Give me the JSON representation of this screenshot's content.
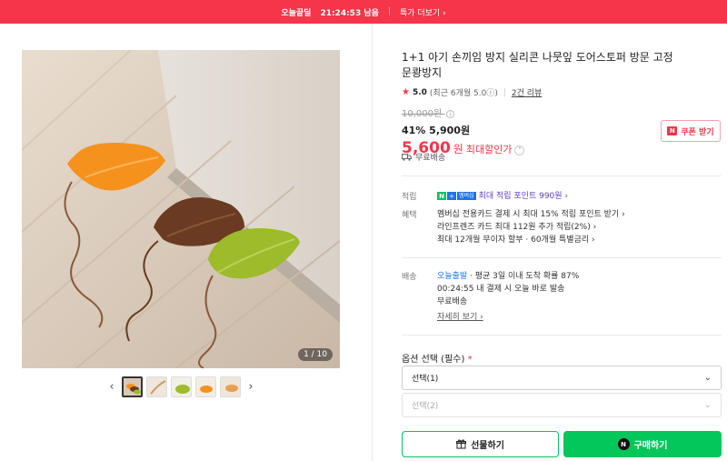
{
  "topbar": {
    "label": "오늘끝딜",
    "timer": "21:24:53 남음",
    "more": "특가 더보기 ›"
  },
  "gallery": {
    "counter": "1 / 10",
    "prev_icon": "chevron-left-icon",
    "next_icon": "chevron-right-icon",
    "thumb_count": 5
  },
  "product": {
    "title": "1+1 아기 손끼임 방지 실리콘 나뭇잎 도어스토퍼 방문 고정 문쾅방지",
    "rating_score": "5.0",
    "rating_recent": "(최근 6개월 5.0ⓘ)",
    "review_count": "2건 리뷰",
    "original_price": "10,000원",
    "discount": "41% 5,900원",
    "final_price": "5,600",
    "final_unit": "원",
    "final_label": "최대할인가",
    "shipping_free": "무료배송"
  },
  "coupon": {
    "label": "쿠폰 받기"
  },
  "info": {
    "point_key": "적립",
    "point_text": "최대 적립 포인트 990원 ›",
    "benefit_key": "혜택",
    "benefit_lines": [
      "멤버십 전용카드 결제 시 최대 15% 적립 포인트 받기 ›",
      "라인프렌즈 카드 최대 112원 추가 적립(2%) ›",
      "최대 12개월 무이자 할부 · 60개월 특별금리 ›"
    ],
    "delivery_key": "배송",
    "delivery_tag": "오늘출발",
    "delivery_line1": "· 평균 3일 이내 도착 확률 87%",
    "delivery_line2": "00:24:55  내 결제 시 오늘 바로 발송",
    "delivery_line3": "무료배송",
    "detail_link": "자세히 보기 ›"
  },
  "options": {
    "label": "옵션 선택 (필수)",
    "required_mark": "*",
    "select1": "선택(1)",
    "select2": "선택(2)"
  },
  "buttons": {
    "gift": "선물하기",
    "buy": "구매하기"
  },
  "colors": {
    "accent": "#f5354a",
    "naver_green": "#03c75a"
  }
}
